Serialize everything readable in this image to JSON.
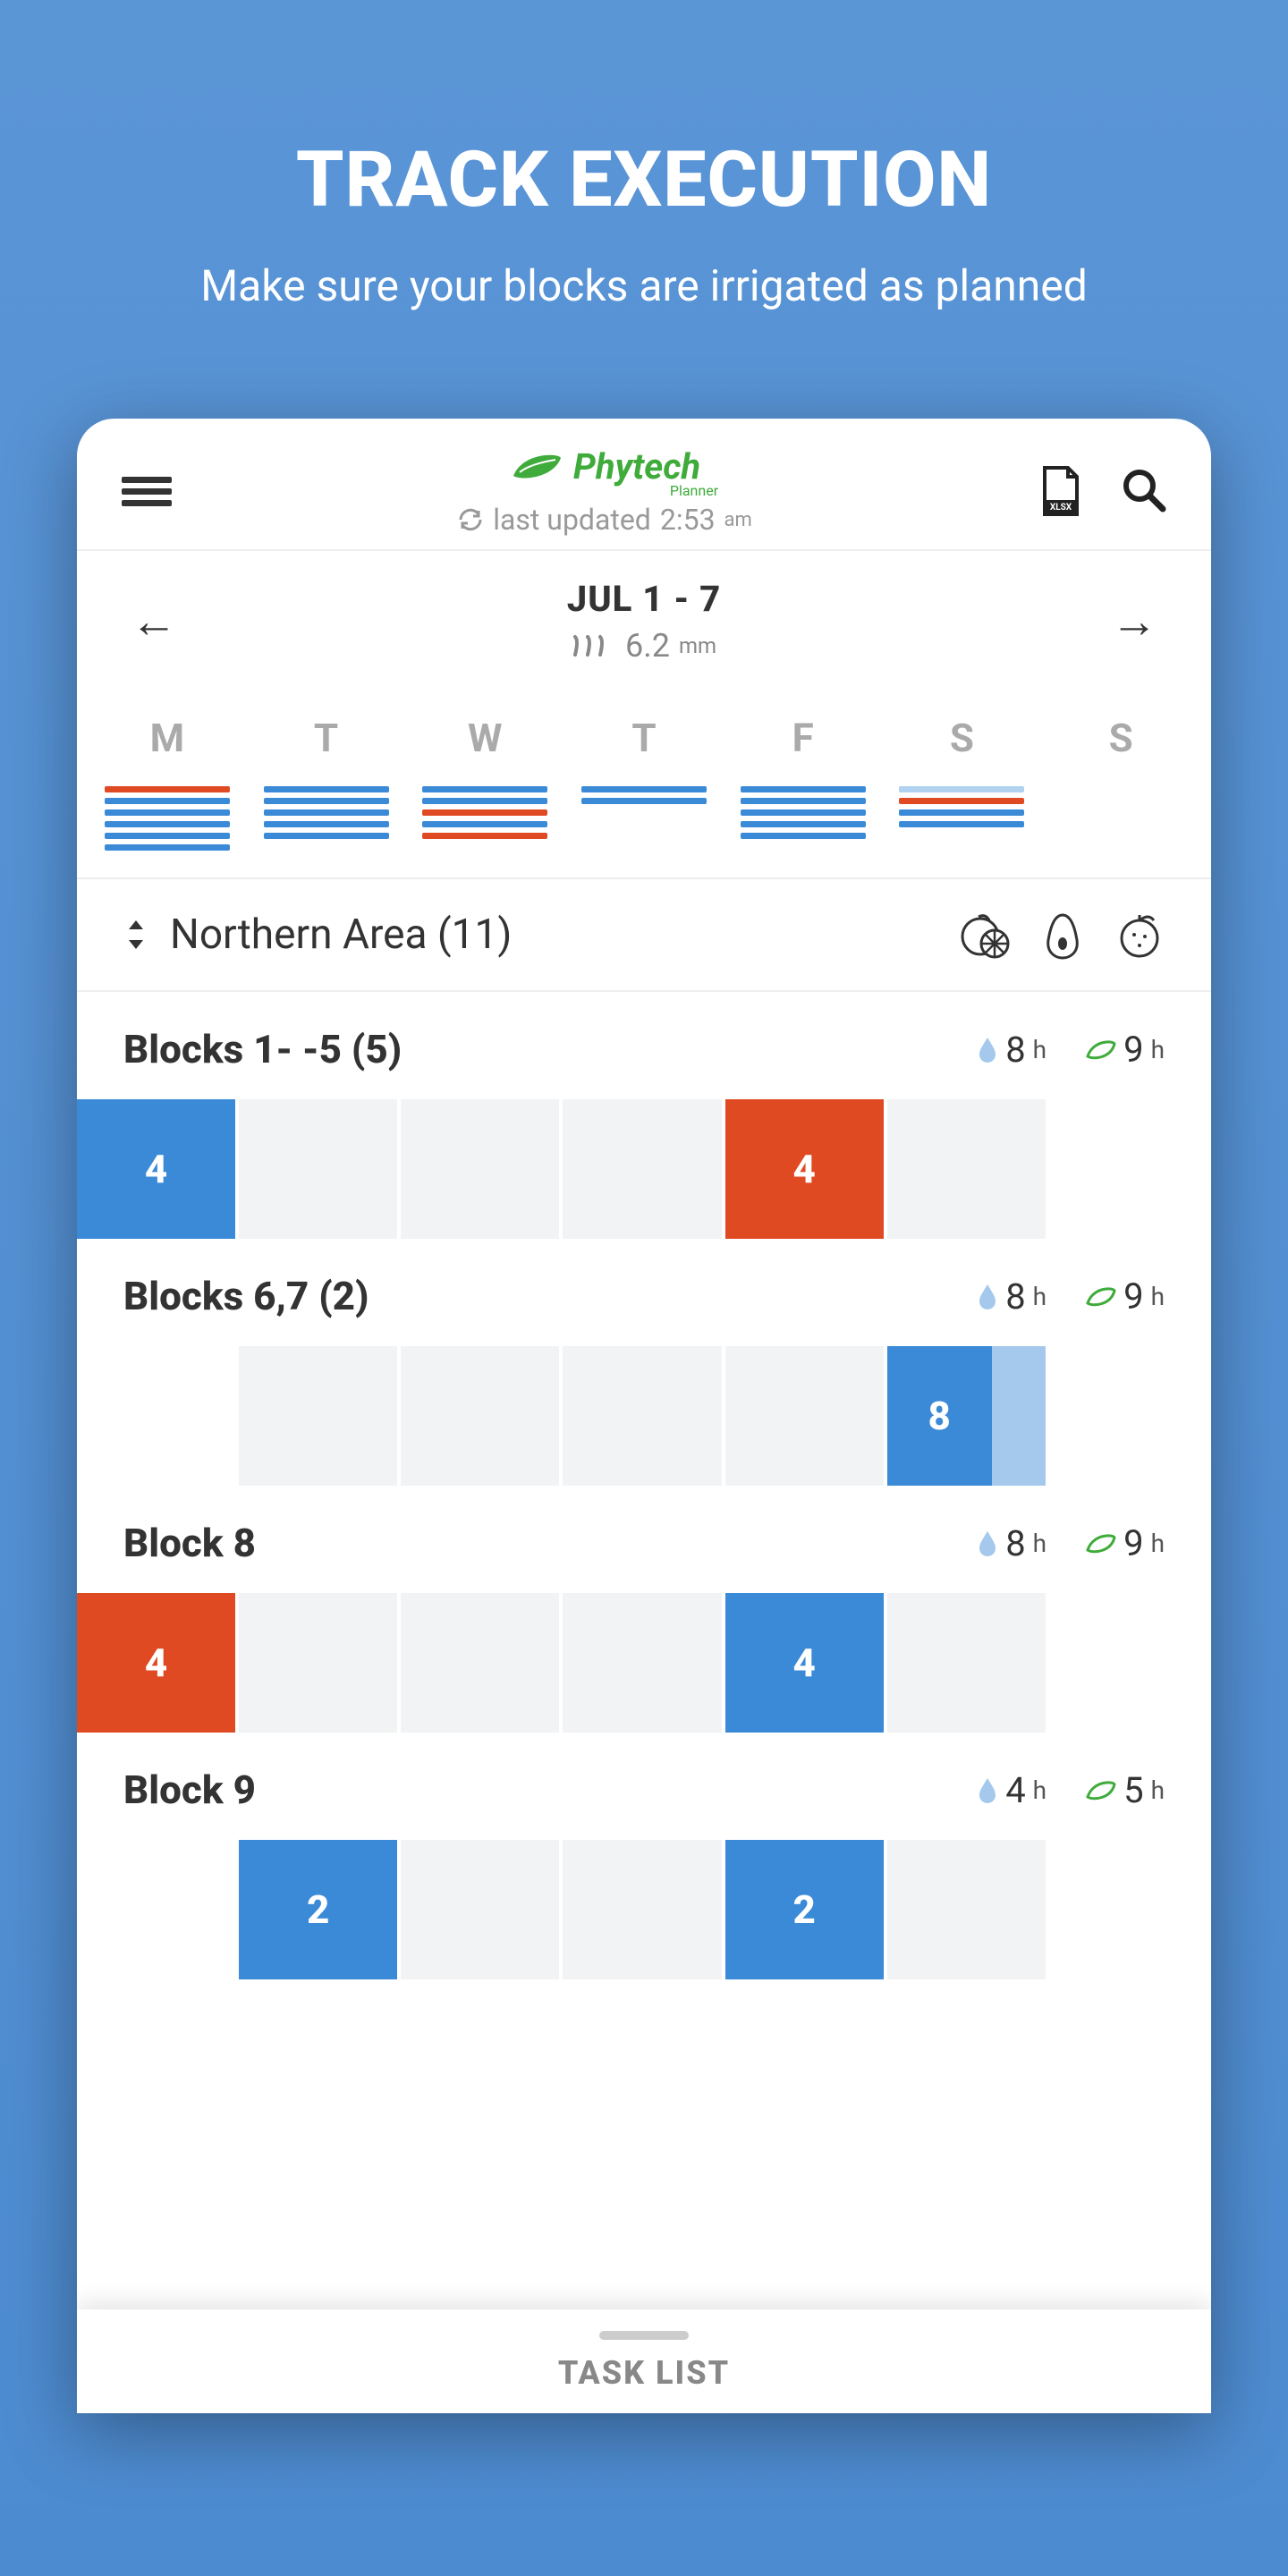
{
  "promo": {
    "title": "TRACK EXECUTION",
    "subtitle": "Make sure your blocks are irrigated as planned"
  },
  "header": {
    "brand": "Phytech",
    "brand_sub": "Planner",
    "last_updated_label": "last updated",
    "last_updated_time": "2:53",
    "last_updated_ampm": "am"
  },
  "date_nav": {
    "range": "JUL 1 - 7",
    "et_value": "6.2",
    "et_unit": "mm"
  },
  "week": {
    "days": [
      "M",
      "T",
      "W",
      "T",
      "F",
      "S",
      "S"
    ],
    "bar_patterns": [
      [
        "orange",
        "blue",
        "blue",
        "blue",
        "blue",
        "blue"
      ],
      [
        "blue",
        "blue",
        "blue",
        "blue",
        "blue"
      ],
      [
        "blue",
        "blue",
        "orange",
        "blue",
        "orange"
      ],
      [
        "blue",
        "blue"
      ],
      [
        "blue",
        "blue",
        "blue",
        "blue",
        "blue"
      ],
      [
        "light",
        "orange",
        "blue",
        "blue"
      ],
      []
    ]
  },
  "area": {
    "name": "Northern Area (11)"
  },
  "blocks": [
    {
      "title": "Blocks 1- -5 (5)",
      "water_h": "8",
      "leaf_h": "9",
      "cells": [
        {
          "type": "blue",
          "val": "4"
        },
        {
          "type": "gray"
        },
        {
          "type": "gray"
        },
        {
          "type": "gray"
        },
        {
          "type": "orange",
          "val": "4"
        },
        {
          "type": "gray"
        },
        {
          "type": "blank"
        }
      ]
    },
    {
      "title": "Blocks 6,7 (2)",
      "water_h": "8",
      "leaf_h": "9",
      "cells": [
        {
          "type": "blank"
        },
        {
          "type": "gray"
        },
        {
          "type": "gray"
        },
        {
          "type": "gray"
        },
        {
          "type": "gray"
        },
        {
          "type": "split",
          "val": "8"
        },
        {
          "type": "blank"
        }
      ]
    },
    {
      "title": "Block 8",
      "water_h": "8",
      "leaf_h": "9",
      "cells": [
        {
          "type": "orange",
          "val": "4"
        },
        {
          "type": "gray"
        },
        {
          "type": "gray"
        },
        {
          "type": "gray"
        },
        {
          "type": "blue",
          "val": "4"
        },
        {
          "type": "gray"
        },
        {
          "type": "blank"
        }
      ]
    },
    {
      "title": "Block 9",
      "water_h": "4",
      "leaf_h": "5",
      "cells": [
        {
          "type": "blank"
        },
        {
          "type": "blue",
          "val": "2"
        },
        {
          "type": "gray"
        },
        {
          "type": "gray"
        },
        {
          "type": "blue",
          "val": "2"
        },
        {
          "type": "gray"
        },
        {
          "type": "blank"
        }
      ]
    }
  ],
  "bottom": {
    "label": "TASK LIST"
  },
  "labels": {
    "h": "h"
  }
}
